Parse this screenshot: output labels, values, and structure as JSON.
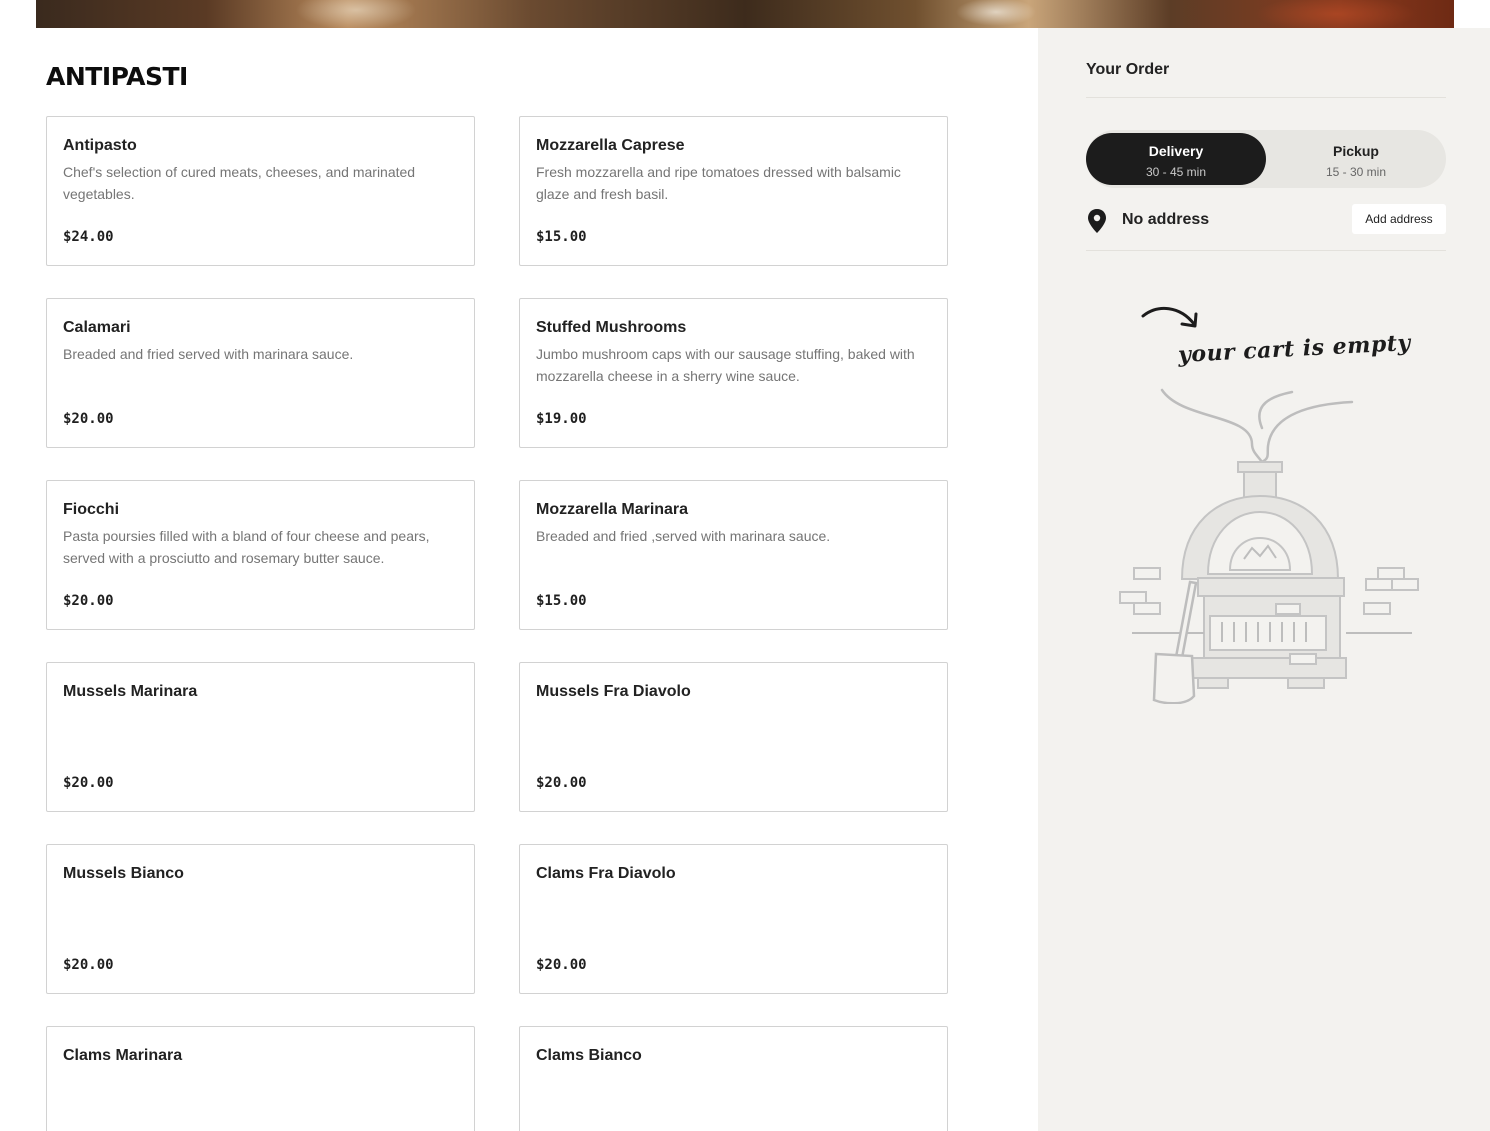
{
  "section": {
    "title": "ANTIPASTI"
  },
  "menu_items": [
    {
      "name": "Antipasto",
      "description": "Chef's selection of cured meats, cheeses, and marinated vegetables.",
      "price": "$24.00"
    },
    {
      "name": "Mozzarella Caprese",
      "description": "Fresh mozzarella and ripe tomatoes dressed with balsamic glaze and fresh basil.",
      "price": "$15.00"
    },
    {
      "name": "Calamari",
      "description": "Breaded and fried served with marinara sauce.",
      "price": "$20.00"
    },
    {
      "name": "Stuffed Mushrooms",
      "description": "Jumbo mushroom caps with our sausage stuffing, baked with mozzarella cheese in a sherry wine sauce.",
      "price": "$19.00"
    },
    {
      "name": "Fiocchi",
      "description": "Pasta poursies filled with a bland of four cheese and pears, served with a prosciutto and rosemary butter sauce.",
      "price": "$20.00"
    },
    {
      "name": "Mozzarella Marinara",
      "description": "Breaded and fried ,served with marinara sauce.",
      "price": "$15.00"
    },
    {
      "name": "Mussels Marinara",
      "description": "",
      "price": "$20.00"
    },
    {
      "name": "Mussels Fra Diavolo",
      "description": "",
      "price": "$20.00"
    },
    {
      "name": "Mussels Bianco",
      "description": "",
      "price": "$20.00"
    },
    {
      "name": "Clams Fra Diavolo",
      "description": "",
      "price": "$20.00"
    },
    {
      "name": "Clams Marinara",
      "description": "",
      "price": ""
    },
    {
      "name": "Clams Bianco",
      "description": "",
      "price": ""
    }
  ],
  "order": {
    "title": "Your Order",
    "delivery": {
      "label": "Delivery",
      "time": "30 - 45 min",
      "selected": true
    },
    "pickup": {
      "label": "Pickup",
      "time": "15 - 30 min",
      "selected": false
    },
    "address": {
      "text": "No address",
      "button": "Add address",
      "icon": "map-pin-icon"
    },
    "empty_cart": {
      "text": "your cart is empty",
      "icon": "arrow-icon",
      "illustration": "pizza-oven-illustration"
    }
  },
  "colors": {
    "sidebar_bg": "#f3f2ef",
    "toggle_active": "#1c1c1c",
    "card_border": "#d2d2d2"
  }
}
